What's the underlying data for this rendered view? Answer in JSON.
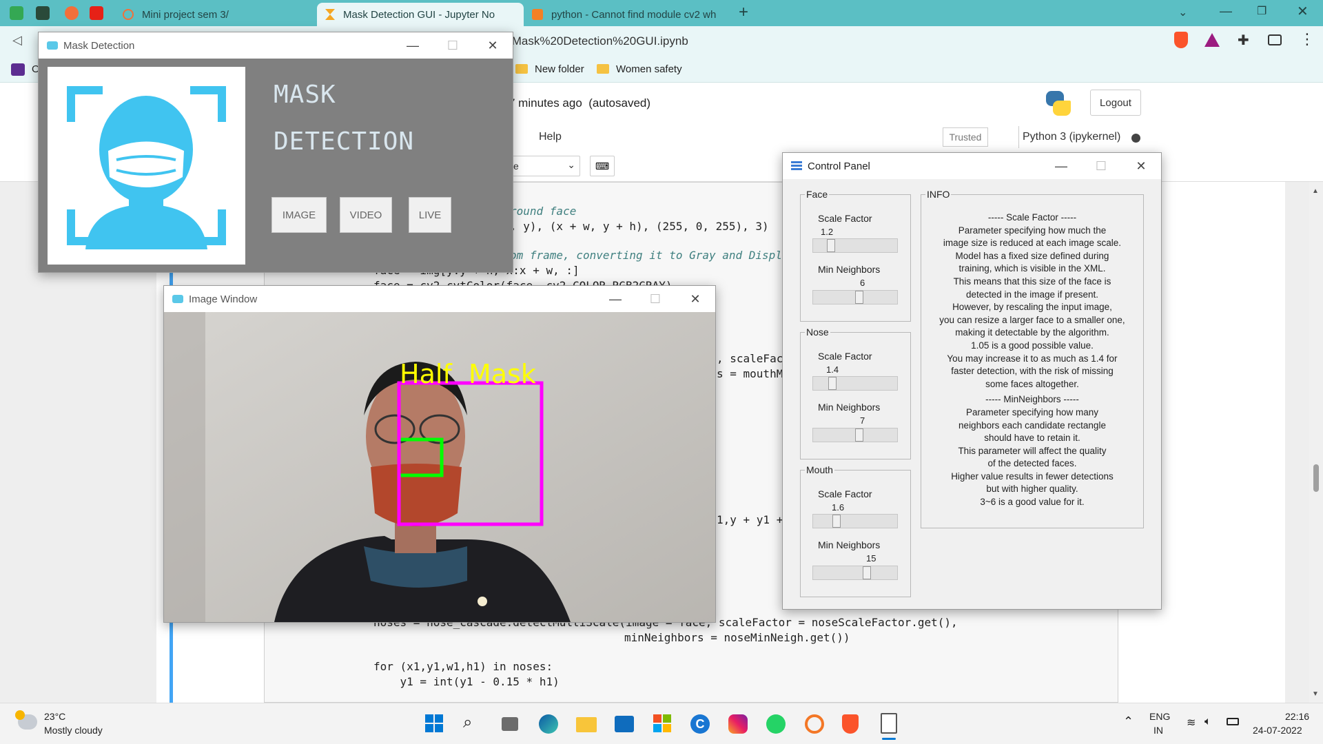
{
  "browser": {
    "tabs": [
      {
        "title": "Mini project sem 3/"
      },
      {
        "title": "Mask Detection GUI - Jupyter No"
      },
      {
        "title": "python - Cannot find module cv2 whe"
      }
    ],
    "new_tab_symbol": "+",
    "url": "/Mask%20Detection%20GUI.ipynb",
    "bookmarks": [
      "New folder",
      "Women safety"
    ],
    "bookmark_partial": "O"
  },
  "jupyter": {
    "save_status": "7 minutes ago",
    "autosaved": "(autosaved)",
    "logout": "Logout",
    "menu_help": "Help",
    "trusted": "Trusted",
    "kernel": "Python 3 (ipykernel)",
    "cell_type_partial": "e",
    "code_lines": [
      "round face",
      ", y), (x + w, y + h), (255, 0, 255), 3)",
      "om frame, converting it to Gray and Displ",
      "face = img[y:y + h, x:x + w, :]",
      "face = cv2.cvtColor(face, cv2.COLOR_RGB2GRAY)",
      ", scaleFac",
      "s = mouthMi",
      "1,y + y1 +",
      "noses = nose_cascade.detectMultiScale(image = face, scaleFactor = noseScaleFactor.get(),",
      "minNeighbors = noseMinNeigh.get())",
      "for (x1,y1,w1,h1) in noses:",
      "    y1 = int(y1 - 0.15 * h1)"
    ]
  },
  "mask_window": {
    "title": "Mask Detection",
    "heading_line1": "MASK",
    "heading_line2": "DETECTION",
    "buttons": [
      "IMAGE",
      "VIDEO",
      "LIVE"
    ]
  },
  "image_window": {
    "title": "Image Window",
    "detection_label": "Half  Mask"
  },
  "control_panel": {
    "title": "Control Panel",
    "groups": [
      {
        "name": "Face",
        "scale_label": "Scale Factor",
        "scale_value": "1.2",
        "scale_fraction": 0.18,
        "neigh_label": "Min Neighbors",
        "neigh_value": "6",
        "neigh_fraction": 0.55
      },
      {
        "name": "Nose",
        "scale_label": "Scale Factor",
        "scale_value": "1.4",
        "scale_fraction": 0.2,
        "neigh_label": "Min Neighbors",
        "neigh_value": "7",
        "neigh_fraction": 0.55
      },
      {
        "name": "Mouth",
        "scale_label": "Scale Factor",
        "scale_value": "1.6",
        "scale_fraction": 0.25,
        "neigh_label": "Min Neighbors",
        "neigh_value": "15",
        "neigh_fraction": 0.65
      }
    ],
    "info_title": "INFO",
    "info_lines": [
      "----- Scale Factor -----",
      "Parameter specifying how much the",
      "image size is reduced at each image scale.",
      "Model has a fixed size defined during",
      "training, which is visible in the XML.",
      "This means that this size of the face is",
      "detected in the image if present.",
      "However, by rescaling the input image,",
      "you can resize a larger face to a smaller one,",
      "making it detectable by the algorithm.",
      "1.05 is a good possible value.",
      "You may increase it to as much as 1.4 for",
      "faster detection, with the risk of missing",
      "some faces altogether.",
      "----- MinNeighbors -----",
      "Parameter specifying how many",
      "neighbors each candidate rectangle",
      "should have to retain it.",
      "This parameter will affect the quality",
      "of the detected faces.",
      "Higher value results in fewer detections",
      "but with higher quality.",
      "3~6 is a good value for it."
    ]
  },
  "taskbar": {
    "temperature": "23°C",
    "weather": "Mostly cloudy",
    "lang": "ENG",
    "region": "IN",
    "time": "22:16",
    "date": "24-07-2022"
  }
}
